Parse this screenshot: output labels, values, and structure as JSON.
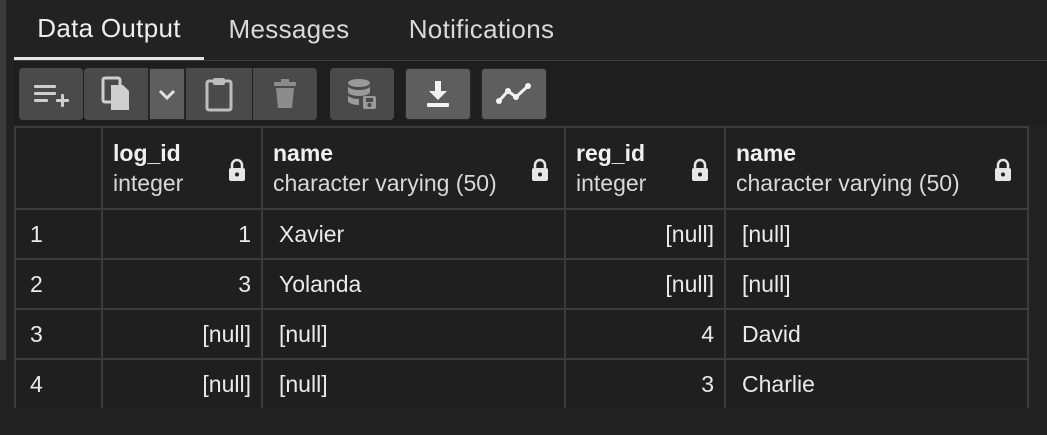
{
  "tabs": [
    "Data Output",
    "Messages",
    "Notifications"
  ],
  "toolbar": {
    "buttons": [
      {
        "name": "add-row-icon"
      },
      {
        "name": "copy-icon"
      },
      {
        "name": "chevron-down-icon"
      },
      {
        "name": "paste-icon"
      },
      {
        "name": "delete-icon"
      },
      {
        "name": "save-data-icon"
      },
      {
        "name": "download-icon"
      },
      {
        "name": "graph-icon"
      }
    ]
  },
  "columns": [
    {
      "name": "log_id",
      "type": "integer"
    },
    {
      "name": "name",
      "type": "character varying (50)"
    },
    {
      "name": "reg_id",
      "type": "integer"
    },
    {
      "name": "name",
      "type": "character varying (50)"
    }
  ],
  "rows": [
    {
      "num": "1",
      "cells": [
        "1",
        "Xavier",
        "[null]",
        "[null]"
      ]
    },
    {
      "num": "2",
      "cells": [
        "3",
        "Yolanda",
        "[null]",
        "[null]"
      ]
    },
    {
      "num": "3",
      "cells": [
        "[null]",
        "[null]",
        "4",
        "David"
      ]
    },
    {
      "num": "4",
      "cells": [
        "[null]",
        "[null]",
        "3",
        "Charlie"
      ]
    }
  ],
  "colors": {
    "background": "#222222",
    "null_text": "#6d6d6d",
    "grid_border": "#3c3c3c"
  }
}
